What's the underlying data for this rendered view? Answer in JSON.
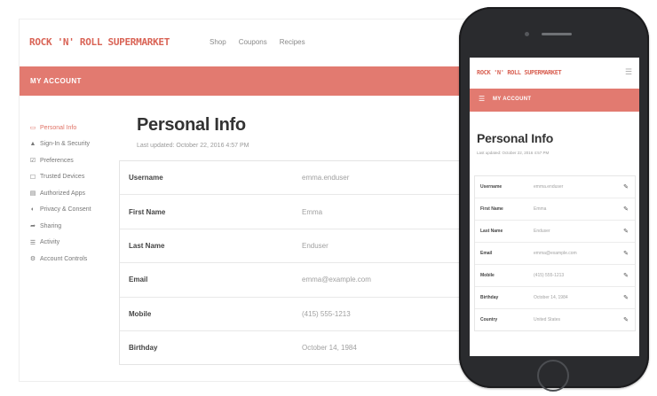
{
  "brand": "ROCK 'N' ROLL SUPERMARKET",
  "nav": [
    "Shop",
    "Coupons",
    "Recipes"
  ],
  "account_banner": "MY ACCOUNT",
  "sidebar": [
    {
      "label": "Personal Info",
      "icon": "id-card-icon",
      "glyph": "▭"
    },
    {
      "label": "Sign-In & Security",
      "icon": "lock-icon",
      "glyph": "🔒"
    },
    {
      "label": "Preferences",
      "icon": "sliders-icon",
      "glyph": "☑"
    },
    {
      "label": "Trusted Devices",
      "icon": "device-icon",
      "glyph": "☐"
    },
    {
      "label": "Authorized Apps",
      "icon": "apps-icon",
      "glyph": "▤"
    },
    {
      "label": "Privacy & Consent",
      "icon": "privacy-icon",
      "glyph": "◐"
    },
    {
      "label": "Sharing",
      "icon": "share-icon",
      "glyph": "➦"
    },
    {
      "label": "Activity",
      "icon": "activity-icon",
      "glyph": "☰"
    },
    {
      "label": "Account Controls",
      "icon": "gear-icon",
      "glyph": "⚙"
    }
  ],
  "page_title": "Personal Info",
  "last_updated_desktop": "Last updated: October 22, 2016 4:57 PM",
  "last_updated_mobile": "Last updated: October 22, 2016 4:57 PM",
  "fields_desktop": [
    {
      "label": "Username",
      "value": "emma.enduser"
    },
    {
      "label": "First Name",
      "value": "Emma"
    },
    {
      "label": "Last Name",
      "value": "Enduser"
    },
    {
      "label": "Email",
      "value": "emma@example.com"
    },
    {
      "label": "Mobile",
      "value": "(415) 555-1213"
    },
    {
      "label": "Birthday",
      "value": "October 14, 1984"
    }
  ],
  "fields_mobile": [
    {
      "label": "Username",
      "value": "emma.enduser"
    },
    {
      "label": "First Name",
      "value": "Emma"
    },
    {
      "label": "Last Name",
      "value": "Enduser"
    },
    {
      "label": "Email",
      "value": "emma@example.com"
    },
    {
      "label": "Mobile",
      "value": "(415) 555-1213"
    },
    {
      "label": "Birthday",
      "value": "October 14, 1984"
    },
    {
      "label": "Country",
      "value": "United States"
    }
  ],
  "colors": {
    "accent": "#e27a70",
    "brand_text": "#d96355",
    "phone_body": "#2a2b2e"
  }
}
